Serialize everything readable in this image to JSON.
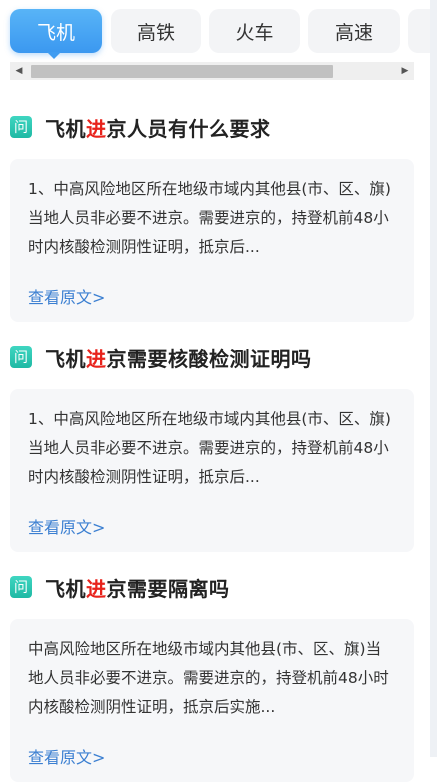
{
  "tabs": [
    {
      "label": "飞机",
      "active": true
    },
    {
      "label": "高铁",
      "active": false
    },
    {
      "label": "火车",
      "active": false
    },
    {
      "label": "高速",
      "active": false
    }
  ],
  "scrollbar": {
    "left_arrow": "◀",
    "right_arrow": "▶"
  },
  "questions": [
    {
      "icon": "问",
      "title_pre": "飞机",
      "title_hl": "进",
      "title_post": "京人员有什么要求",
      "text": "1、中高风险地区所在地级市域内其他县(市、区、旗)当地人员非必要不进京。需要进京的，持登机前48小时内核酸检测阴性证明，抵京后...",
      "link": "查看原文>"
    },
    {
      "icon": "问",
      "title_pre": "飞机",
      "title_hl": "进",
      "title_post": "京需要核酸检测证明吗",
      "text": "1、中高风险地区所在地级市域内其他县(市、区、旗)当地人员非必要不进京。需要进京的，持登机前48小时内核酸检测阴性证明，抵京后...",
      "link": "查看原文>"
    },
    {
      "icon": "问",
      "title_pre": "飞机",
      "title_hl": "进",
      "title_post": "京需要隔离吗",
      "text": "中高风险地区所在地级市域内其他县(市、区、旗)当地人员非必要不进京。需要进京的，持登机前48小时内核酸检测阴性证明，抵京后实施...",
      "link": "查看原文>"
    }
  ],
  "colors": {
    "accent": "#3b98f0",
    "highlight": "#e8231c",
    "link": "#3b7fd1",
    "qicon": "#2cc7b2"
  }
}
